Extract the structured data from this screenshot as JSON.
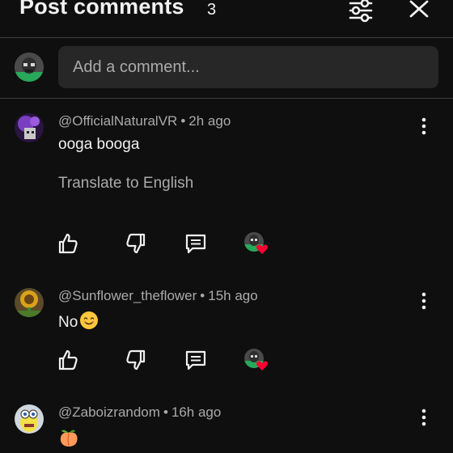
{
  "header": {
    "title": "Post comments",
    "count": "3"
  },
  "composer": {
    "placeholder": "Add a comment..."
  },
  "comments": [
    {
      "author": "@OfficialNaturalVR",
      "time": "2h ago",
      "text": "ooga booga",
      "translate_label": "Translate to English"
    },
    {
      "author": "@Sunflower_theflower",
      "time": "15h ago",
      "text": "No",
      "text_emoji": "smiling-face-emoji"
    },
    {
      "author": "@Zaboizrandom",
      "time": "16h ago",
      "text_emoji": "peach-emoji"
    }
  ],
  "separator": "•",
  "colors": {
    "background": "#0f0f0f",
    "input_background": "#272727",
    "secondary_text": "#aaaaaa",
    "heart": "#ff0033"
  }
}
